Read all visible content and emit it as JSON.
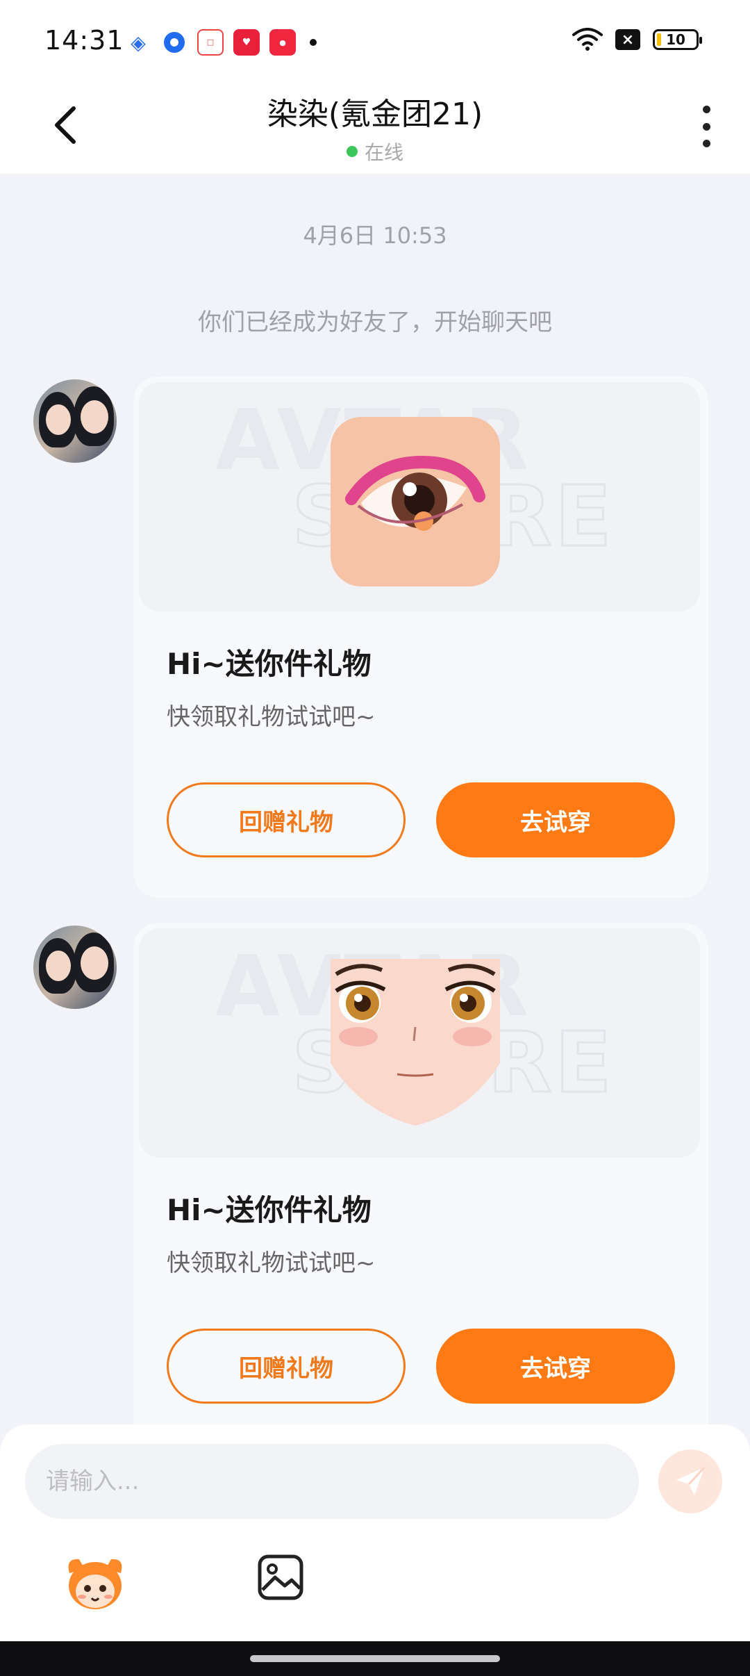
{
  "status_bar": {
    "time": "14:31",
    "notification_icons": [
      "baidu-icon",
      "browser-icon",
      "fish-video-icon",
      "heart-app-icon",
      "xiaohongshu-icon"
    ],
    "battery_level": "10"
  },
  "header": {
    "title": "染染(氪金团21)",
    "status": "在线"
  },
  "chat": {
    "timestamp": "4月6日 10:53",
    "system_message": "你们已经成为好友了，开始聊天吧",
    "messages": [
      {
        "image": "eye-makeup-item",
        "heading": "Hi~送你件礼物",
        "subtitle": "快领取礼物试试吧~",
        "return_gift_label": "回赠礼物",
        "try_on_label": "去试穿"
      },
      {
        "image": "face-item",
        "heading": "Hi~送你件礼物",
        "subtitle": "快领取礼物试试吧~",
        "return_gift_label": "回赠礼物",
        "try_on_label": "去试穿"
      }
    ]
  },
  "input": {
    "placeholder": "请输入..."
  },
  "colors": {
    "accent": "#ff7a12",
    "online": "#3cc75a",
    "background": "#f2f3f8"
  }
}
